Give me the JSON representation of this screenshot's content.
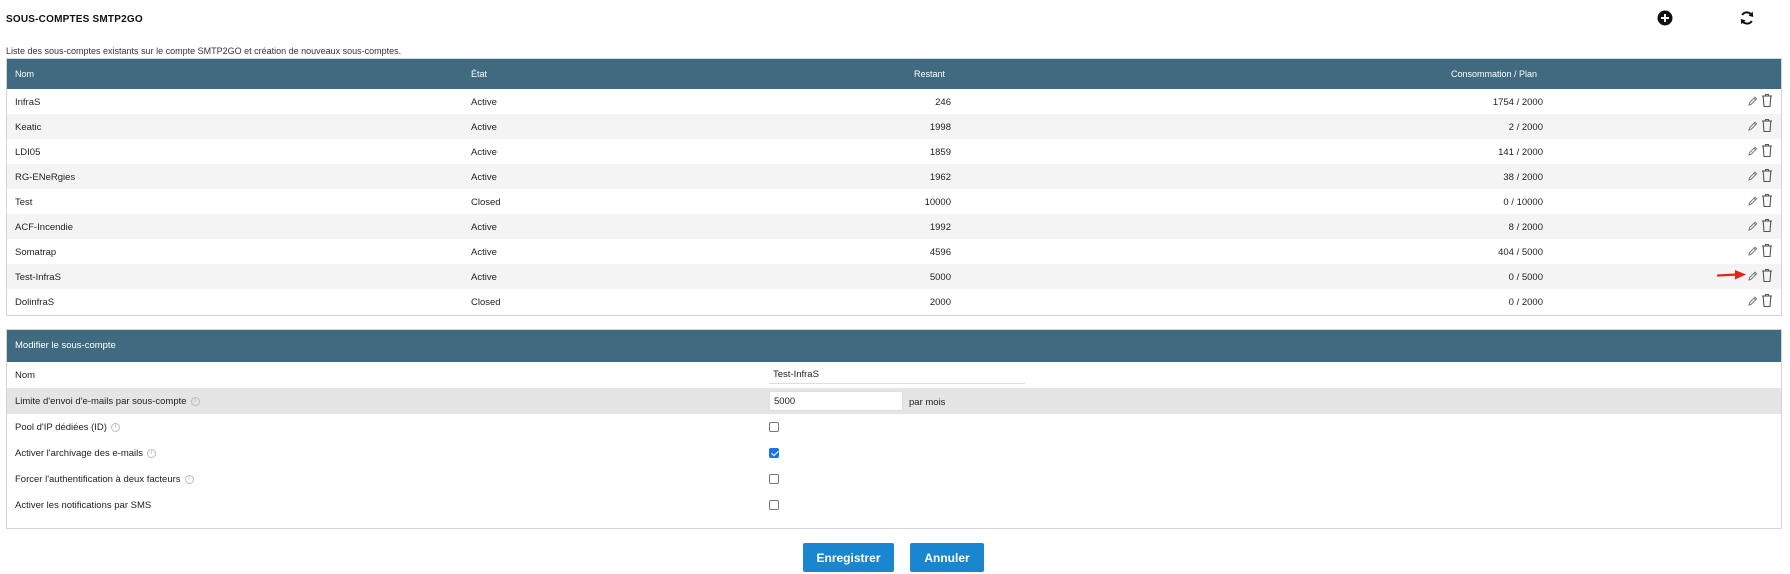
{
  "page": {
    "title": "SOUS-COMPTES SMTP2GO",
    "description": "Liste des sous-comptes existants sur le compte SMTP2GO et création de nouveaux sous-comptes."
  },
  "table": {
    "headers": {
      "nom": "Nom",
      "etat": "État",
      "restant": "Restant",
      "consommation": "Consommation / Plan"
    },
    "rows": [
      {
        "nom": "InfraS",
        "etat": "Active",
        "restant": "246",
        "consommation": "1754 / 2000"
      },
      {
        "nom": "Keatic",
        "etat": "Active",
        "restant": "1998",
        "consommation": "2 / 2000"
      },
      {
        "nom": "LDI05",
        "etat": "Active",
        "restant": "1859",
        "consommation": "141 / 2000"
      },
      {
        "nom": "RG-ENeRgies",
        "etat": "Active",
        "restant": "1962",
        "consommation": "38 / 2000"
      },
      {
        "nom": "Test",
        "etat": "Closed",
        "restant": "10000",
        "consommation": "0 / 10000"
      },
      {
        "nom": "ACF-Incendie",
        "etat": "Active",
        "restant": "1992",
        "consommation": "8 / 2000"
      },
      {
        "nom": "Somatrap",
        "etat": "Active",
        "restant": "4596",
        "consommation": "404 / 5000"
      },
      {
        "nom": "Test-InfraS",
        "etat": "Active",
        "restant": "5000",
        "consommation": "0 / 5000"
      },
      {
        "nom": "DolinfraS",
        "etat": "Closed",
        "restant": "2000",
        "consommation": "0 / 2000"
      }
    ]
  },
  "edit": {
    "title": "Modifier le sous-compte",
    "nom_label": "Nom",
    "nom_value": "Test-InfraS",
    "limit_label": "Limite d'envoi d'e-mails par sous-compte",
    "limit_value": "5000",
    "limit_suffix": "par mois",
    "pool_label": "Pool d'IP dédiées (ID)",
    "archive_label": "Activer l'archivage des e-mails",
    "twofa_label": "Forcer l'authentification à deux facteurs",
    "sms_label": "Activer les notifications par SMS",
    "info_glyph": "i",
    "pool_checked": false,
    "archive_checked": true,
    "twofa_checked": false,
    "sms_checked": false
  },
  "buttons": {
    "save": "Enregistrer",
    "cancel": "Annuler"
  },
  "colors": {
    "header_bg": "#3f6a80",
    "button_bg": "#1a86cf",
    "arrow": "#e3241b"
  },
  "icons": {
    "add": "plus-circle-icon",
    "refresh": "refresh-icon",
    "edit": "pencil-icon",
    "delete": "trash-icon",
    "highlight": "red-arrow-icon"
  }
}
